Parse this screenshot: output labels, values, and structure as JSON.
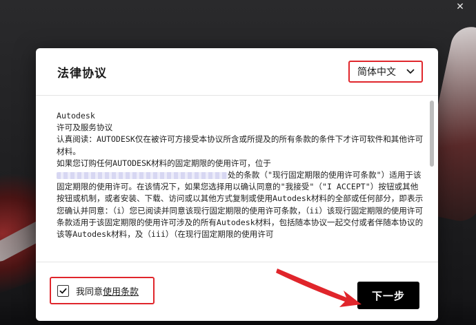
{
  "window": {
    "close_glyph": "✕"
  },
  "dialog": {
    "title": "法律协议",
    "language": {
      "selected": "简体中文",
      "icon": "chevron-down-icon"
    },
    "license": {
      "lines": [
        "Autodesk",
        "许可及服务协议",
        "认真阅读：AUTODESK仅在被许可方接受本协议所含或所提及的所有条款的条件下才许可软件和其他许可材料。",
        "如果您订购任何AUTODESK材料的固定期限的使用许可，位于"
      ],
      "line_after_redact": "处的条款（\"现行固定期限的使用许可条款\"）适用于该固定期限的使用许可。在该情况下，如果您选择用以确认同意的\"我接受\"（\"I ACCEPT\"）按钮或其他按钮或机制，或者安装、下载、访问或以其他方式复制或使用Autodesk材料的全部或任何部分，即表示您确认并同意：（i）您已阅读并同意该现行固定期限的使用许可条款，（ii）该现行固定期限的使用许可条款适用于该固定期限的使用许可涉及的所有Autodesk材料，包括随本协议一起交付或者伴随本协议的该等Autodesk材料，及（iii）（在现行固定期限的使用许可"
    },
    "agree": {
      "checked": true,
      "prefix": "我同意",
      "link": "使用条款"
    },
    "next_label": "下一步"
  },
  "colors": {
    "highlight": "#e0252b",
    "primary_button": "#000000"
  }
}
